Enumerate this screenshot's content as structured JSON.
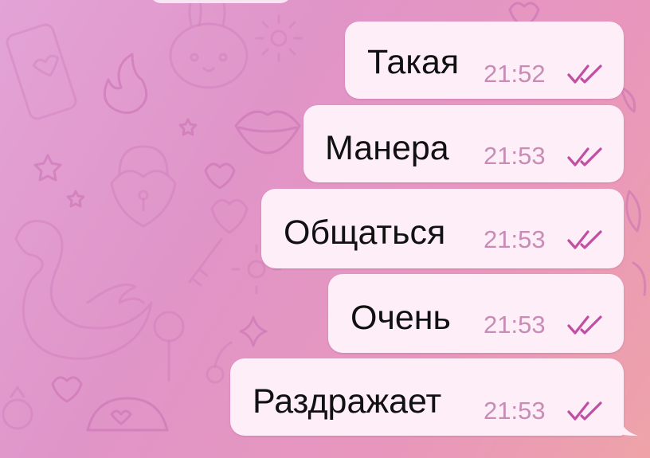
{
  "theme": {
    "bubble_color": "#fdeef8",
    "check_color": "#c04fa4",
    "time_color": "#c88cb6"
  },
  "messages": [
    {
      "text": "Такая",
      "time": "21:52",
      "status_icon": "double-check-read-icon"
    },
    {
      "text": "Манера",
      "time": "21:53",
      "status_icon": "double-check-read-icon"
    },
    {
      "text": "Общаться",
      "time": "21:53",
      "status_icon": "double-check-read-icon"
    },
    {
      "text": "Очень",
      "time": "21:53",
      "status_icon": "double-check-read-icon"
    },
    {
      "text": "Раздражает",
      "time": "21:53",
      "status_icon": "double-check-read-icon"
    }
  ]
}
